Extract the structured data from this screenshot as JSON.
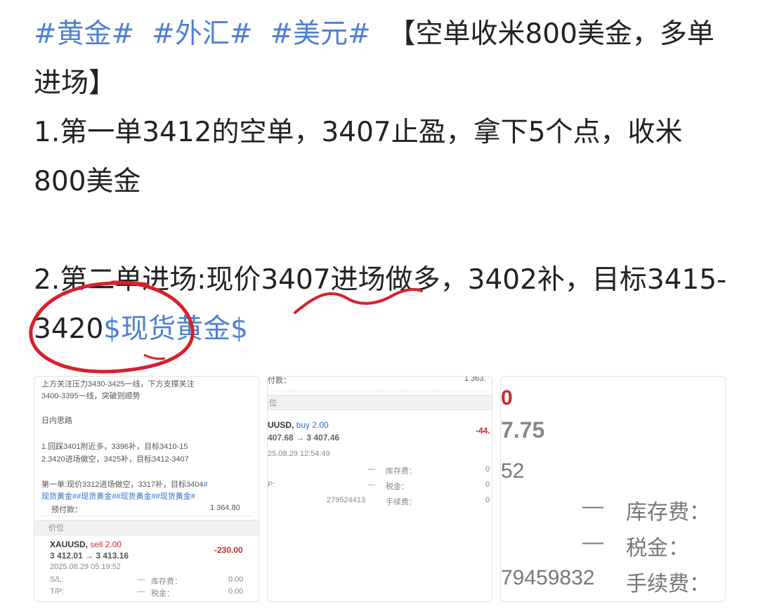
{
  "post": {
    "tags": [
      "#黄金#",
      "#外汇#",
      "#美元#"
    ],
    "headline": "【空单收米800美金，多单进场】",
    "line1": "1.第一单3412的空单，3407止盈，拿下5个点，收米800美金",
    "line2_a": "2.第二单进场:现价3407进场做多，3402补，目标3415-3420",
    "stock_tag": "$现货黄金$"
  },
  "thumb1": {
    "l1": "上方关注压力3430-3425一线，下方支撑关注",
    "l2": "3400-3395一线，突破则顺势",
    "l3": "日内思路",
    "l4": "1.回踩3401附近多，3396补，目标3410-15",
    "l5": "2.3420进场做空，3425补，目标3412-3407",
    "l6": "第一单:现价3312进场做空，3317补，目标3404",
    "l6_tag": "#",
    "l7": "现货黄金##现货黄金##现货黄金##现货黄金#",
    "prepaid_label": "预付款：",
    "prepaid_value": "1 364.80",
    "section": "价位",
    "symbol": "XAUUSD,",
    "side": "sell 2.00",
    "pnl": "-230.00",
    "prices": "3 412.01 → 3 413.16",
    "time": "2025.08.29 05:19:52",
    "sl_label": "S/L:",
    "sl_dash": "—",
    "swap_label": "库存费：",
    "swap_value": "0.00",
    "tp_label": "T/P:",
    "tp_dash": "—",
    "tax_label": "税金：",
    "tax_value": "0.00"
  },
  "thumb2": {
    "top": "付款：",
    "top_value": "1 363.",
    "section": "位",
    "symbol": "UUSD,",
    "side": "buy 2.00",
    "pnl": "-44.",
    "prices": "407.68 → 3 407.46",
    "time": "25.08.29 12:54:49",
    "r1_dash": "—",
    "r1_label": "库存费：",
    "r1_value": "0",
    "r2_label": "P:",
    "r2_dash": "—",
    "r2_key": "税金：",
    "r2_value": "0",
    "r3_id": "279524413",
    "r3_label": "手续费：",
    "r3_value": "0"
  },
  "thumb3": {
    "top": "0",
    "value": "7.75",
    "sub": "52",
    "r1_dash": "—",
    "r1_label": "库存费：",
    "r2_dash": "—",
    "r2_label": "税金：",
    "r3_id": "79459832",
    "r3_label": "手续费："
  }
}
